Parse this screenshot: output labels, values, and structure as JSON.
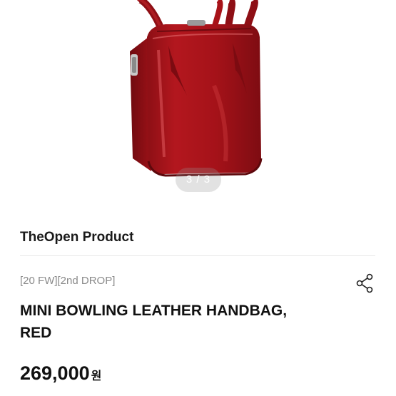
{
  "gallery": {
    "indicator": "3 / 3",
    "photo_icon": "red-patent-leather-handbag"
  },
  "product": {
    "brand": "TheOpen Product",
    "tags": "[20 FW][2nd DROP]",
    "title_line1": "MINI BOWLING LEATHER HANDBAG,",
    "title_line2": "RED",
    "price": "269,000",
    "currency": "원"
  },
  "actions": {
    "share_icon": "share-icon"
  },
  "colors": {
    "bag": "#b0151c",
    "bag_dark": "#7e0c12",
    "bag_highlight": "#d9454a",
    "indicator_bg": "#bdbdbd"
  }
}
